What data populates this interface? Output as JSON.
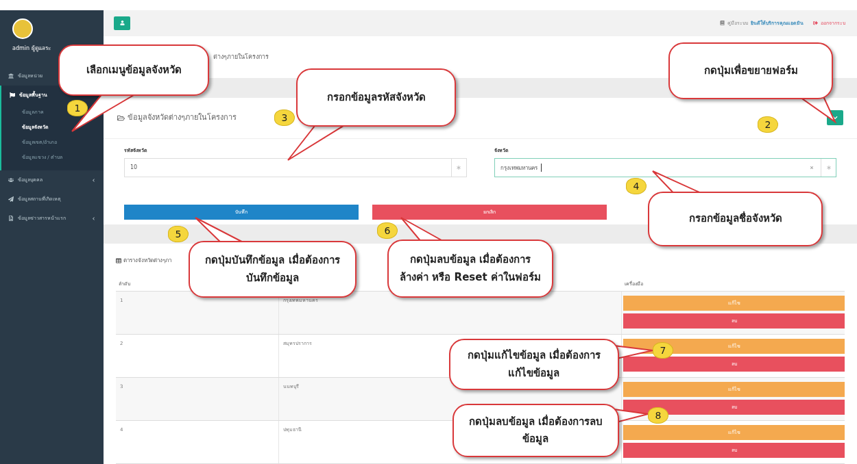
{
  "sidebar": {
    "user": "admin ผู้ดูแลระ",
    "items": [
      {
        "label": "ข้อมูลหน่วย",
        "kind": "link",
        "selected": false
      },
      {
        "label": "ข้อมูลพื้นฐาน",
        "kind": "group",
        "selected": true,
        "has_arrow": false,
        "children": [
          {
            "label": "ข้อมูลภาค",
            "selected": false
          },
          {
            "label": "ข้อมูลจังหวัด",
            "selected": true
          },
          {
            "label": "ข้อมูลเขต/อำเภอ",
            "selected": false
          },
          {
            "label": "ข้อมูลแขวง / ตำบล",
            "selected": false
          }
        ]
      },
      {
        "label": "ข้อมูลบุคคล",
        "kind": "link",
        "selected": false,
        "has_arrow": true
      },
      {
        "label": "ข้อมูลสถานที่เกิดเหตุ",
        "kind": "link",
        "selected": false,
        "has_arrow": false
      },
      {
        "label": "ข้อมูลข่าวสารหน้าแรก",
        "kind": "link",
        "selected": false,
        "has_arrow": true
      }
    ]
  },
  "topbar": {
    "manual": "คู่มือระบบ",
    "welcome": "ยินดีให้บริการคุณแอดมิน",
    "logout": "ออกจากระบ"
  },
  "breadcrumb": "ต่างๆภายในโครงการ",
  "form": {
    "title": "ข้อมูลจังหวัดต่างๆภายในโครงการ",
    "fields": [
      {
        "label": "รหัสจังหวัด",
        "value": "10",
        "focused": false
      },
      {
        "label": "จังหวัด",
        "value": "กรุงเทพมหานคร",
        "focused": true
      }
    ],
    "buttons": [
      {
        "label": "บันทึก",
        "kind": "primary"
      },
      {
        "label": "ยกเลิก",
        "kind": "danger"
      }
    ]
  },
  "table": {
    "title": "ตารางจังหวัดต่างๆภา",
    "columns": [
      "ลำดับ",
      "เครื่องมือ"
    ],
    "rows": [
      {
        "index": "1",
        "name": "กรุงเทพมหานคร",
        "edit": "แก้ไข",
        "delete": "ลบ"
      },
      {
        "index": "2",
        "name": "สมุทรปราการ",
        "edit": "แก้ไข",
        "delete": "ลบ"
      },
      {
        "index": "3",
        "name": "นนทบุรี",
        "edit": "แก้ไข",
        "delete": "ลบ"
      },
      {
        "index": "4",
        "name": "ปทุมธานี",
        "edit": "แก้ไข",
        "delete": "ลบ"
      }
    ]
  },
  "callouts": [
    {
      "badge": "1",
      "text": "เลือกเมนูข้อมูลจังหวัด"
    },
    {
      "badge": "2",
      "text": "กดปุ่มเพื่อขยายฟอร์ม"
    },
    {
      "badge": "3",
      "text": "กรอกข้อมูลรหัสจังหวัด"
    },
    {
      "badge": "4",
      "text": "กรอกข้อมูลชื่อจังหวัด"
    },
    {
      "badge": "5",
      "text": "กดปุ่มบันทึกข้อมูล เมื่อต้องการ\nบันทึกข้อมูล"
    },
    {
      "badge": "6",
      "text": "กดปุ่มลบข้อมูล เมื่อต้องการ\nล้างค่า หรือ Reset ค่าในฟอร์ม"
    },
    {
      "badge": "7",
      "text": "กดปุ่มแก้ไขข้อมูล เมื่อต้องการ\nแก้ไขข้อมูล"
    },
    {
      "badge": "8",
      "text": "กดปุ่มลบข้อมูล เมื่อต้องการลบ\nข้อมูล"
    }
  ]
}
